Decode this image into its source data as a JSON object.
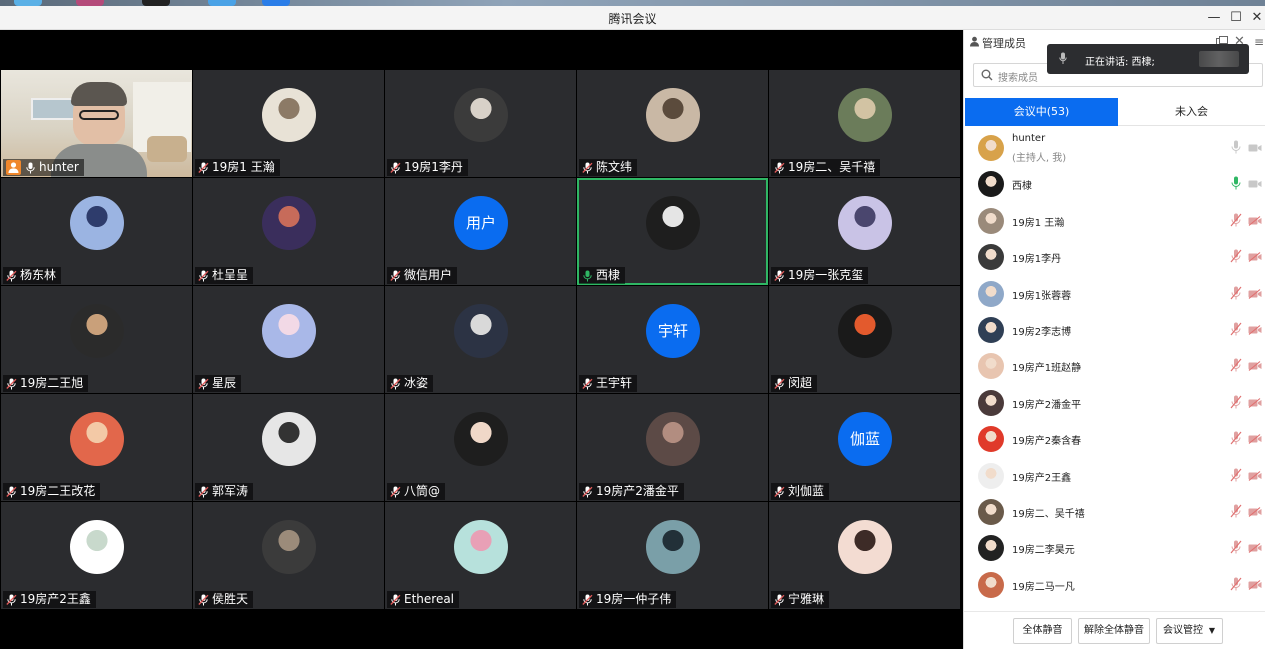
{
  "window": {
    "title": "腾讯会议"
  },
  "speaking": {
    "label": "正在讲话: 西棣;"
  },
  "panel": {
    "title": "管理成员",
    "search_placeholder": "搜索成员",
    "tab_in_meeting": "会议中(53)",
    "tab_not_joined": "未入会"
  },
  "tiles": [
    {
      "name": "hunter",
      "host": true,
      "video": true
    },
    {
      "name": "19房1 王瀚"
    },
    {
      "name": "19房1李丹"
    },
    {
      "name": "陈文纬"
    },
    {
      "name": "19房二、吴千禧"
    },
    {
      "name": "杨东林"
    },
    {
      "name": "杜呈呈"
    },
    {
      "name": "微信用户",
      "avatar_text": "用户"
    },
    {
      "name": "西棣",
      "active": true
    },
    {
      "name": "19房一张克玺"
    },
    {
      "name": "19房二王旭"
    },
    {
      "name": "星辰"
    },
    {
      "name": "冰姿"
    },
    {
      "name": "王宇轩",
      "avatar_text": "宇轩"
    },
    {
      "name": "闵超"
    },
    {
      "name": "19房二王改花"
    },
    {
      "name": "郭军涛"
    },
    {
      "name": "八筒@"
    },
    {
      "name": "19房产2潘金平"
    },
    {
      "name": "刘伽蓝",
      "avatar_text": "伽蓝"
    },
    {
      "name": "19房产2王鑫"
    },
    {
      "name": "侯胜天"
    },
    {
      "name": "Ethereal"
    },
    {
      "name": "19房一仲子伟"
    },
    {
      "name": "宁雅琳"
    }
  ],
  "members": [
    {
      "name": "hunter",
      "sub": "(主持人, 我)"
    },
    {
      "name": "西棣"
    },
    {
      "name": "19房1 王瀚"
    },
    {
      "name": "19房1李丹"
    },
    {
      "name": "19房1张蓉蓉"
    },
    {
      "name": "19房2李志博"
    },
    {
      "name": "19房产1班赵静"
    },
    {
      "name": "19房产2潘金平"
    },
    {
      "name": "19房产2秦含春"
    },
    {
      "name": "19房产2王鑫"
    },
    {
      "name": "19房二、吴千禧"
    },
    {
      "name": "19房二李昊元"
    },
    {
      "name": "19房二马一凡"
    }
  ],
  "footer": {
    "mute_all": "全体静音",
    "unmute_all": "解除全体静音",
    "control": "会议管控"
  },
  "colors": {
    "accent": "#0a6cf0",
    "active_border": "#2fb764",
    "host_badge": "#f0872b",
    "muted_red": "#e06c6c"
  },
  "icons": [
    "user-icon",
    "mic-icon",
    "mic-muted-icon",
    "camera-off-icon",
    "search-icon",
    "close-icon",
    "popout-icon",
    "chevron-down-icon"
  ]
}
